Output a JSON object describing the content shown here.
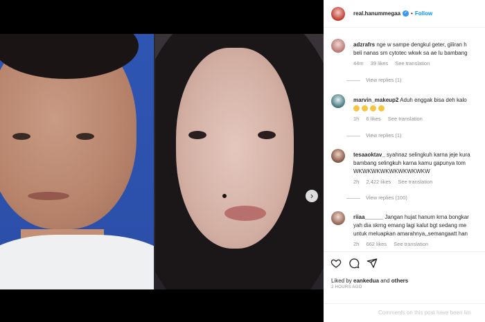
{
  "header": {
    "username": "real.hanummegaa",
    "separator": "•",
    "follow_label": "Follow"
  },
  "comments": [
    {
      "username": "adzrafrs",
      "line1": "nge w sampe dengkul geter, giliran h",
      "line2": "beli nanas sm cytotec wkwk sa ae lu bambang",
      "time": "44m",
      "likes": "39 likes",
      "translate": "See translation",
      "replies": "View replies (1)"
    },
    {
      "username": "marvin_makeup2",
      "line1": "Aduh enggak bisa deh kalo",
      "time": "1h",
      "likes": "6 likes",
      "translate": "See translation",
      "replies": "View replies (1)"
    },
    {
      "username": "tesaaoktav_",
      "line1": "syahnaz selingkuh karna jeje kura",
      "line2": "bambang selingkuh karna kamu gapunya tom",
      "line3": "WKWKWKWKWKWKWKWKW",
      "time": "2h",
      "likes": "2,422 likes",
      "translate": "See translation",
      "replies": "View replies (100)"
    },
    {
      "username": "riiaa______",
      "line1": "Jangan hujat hanum krna bongkar",
      "line2": "yah dia skrng emang lagi kalut bgt sedang me",
      "line3": "untuk meluapkan amarahnya,,semangaatt han",
      "time": "2h",
      "likes": "662 likes",
      "translate": "See translation"
    }
  ],
  "footer": {
    "liked_prefix": "Liked by",
    "liked_user": "eankedua",
    "liked_and": "and",
    "liked_others": "others",
    "time_ago": "2 HOURS AGO",
    "comments_limited": "Comments on this post have been lim"
  },
  "icons": [
    "heart-icon",
    "comment-icon",
    "share-icon",
    "chevron-right-icon",
    "verified-icon"
  ],
  "colors": {
    "accent": "#0095f6",
    "verified": "#3897f0",
    "muted": "#8e8e8e",
    "text": "#262626"
  },
  "carousel": {
    "total_slides": 2,
    "active_slide": 1
  }
}
